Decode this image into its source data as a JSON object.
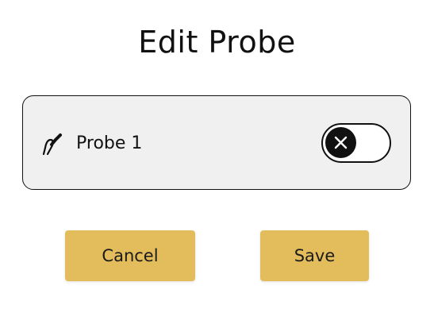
{
  "dialog": {
    "title": "Edit Probe"
  },
  "probe": {
    "icon": "probe-icon",
    "label": "Probe 1",
    "toggle": {
      "state": "off",
      "knob_icon": "close-icon"
    }
  },
  "actions": {
    "cancel_label": "Cancel",
    "save_label": "Save"
  },
  "colors": {
    "button_background": "#e3bd5b",
    "card_background": "#f0f0f0",
    "toggle_knob": "#111111"
  }
}
